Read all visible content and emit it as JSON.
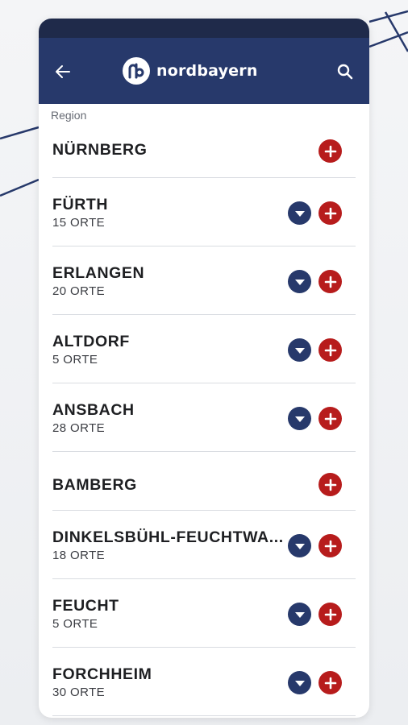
{
  "app": {
    "brand": "nordbayern"
  },
  "colors": {
    "header": "#27396b",
    "statusbar": "#1f2a4a",
    "add": "#b71c1c",
    "expand": "#27396b"
  },
  "icons": {
    "back": "arrow-left-icon",
    "search": "search-icon",
    "logo": "nb-logo-icon",
    "expand": "chevron-down-icon",
    "add": "plus-icon"
  },
  "section": {
    "label": "Region"
  },
  "regions": [
    {
      "name": "NÜRNBERG",
      "count": ""
    },
    {
      "name": "FÜRTH",
      "count": "15 ORTE"
    },
    {
      "name": "ERLANGEN",
      "count": "20 ORTE"
    },
    {
      "name": "ALTDORF",
      "count": "5 ORTE"
    },
    {
      "name": "ANSBACH",
      "count": "28 ORTE"
    },
    {
      "name": "BAMBERG",
      "count": ""
    },
    {
      "name": "DINKELSBÜHL-FEUCHTWA...",
      "count": "18 ORTE"
    },
    {
      "name": "FEUCHT",
      "count": "5 ORTE"
    },
    {
      "name": "FORCHHEIM",
      "count": "30 ORTE"
    }
  ]
}
